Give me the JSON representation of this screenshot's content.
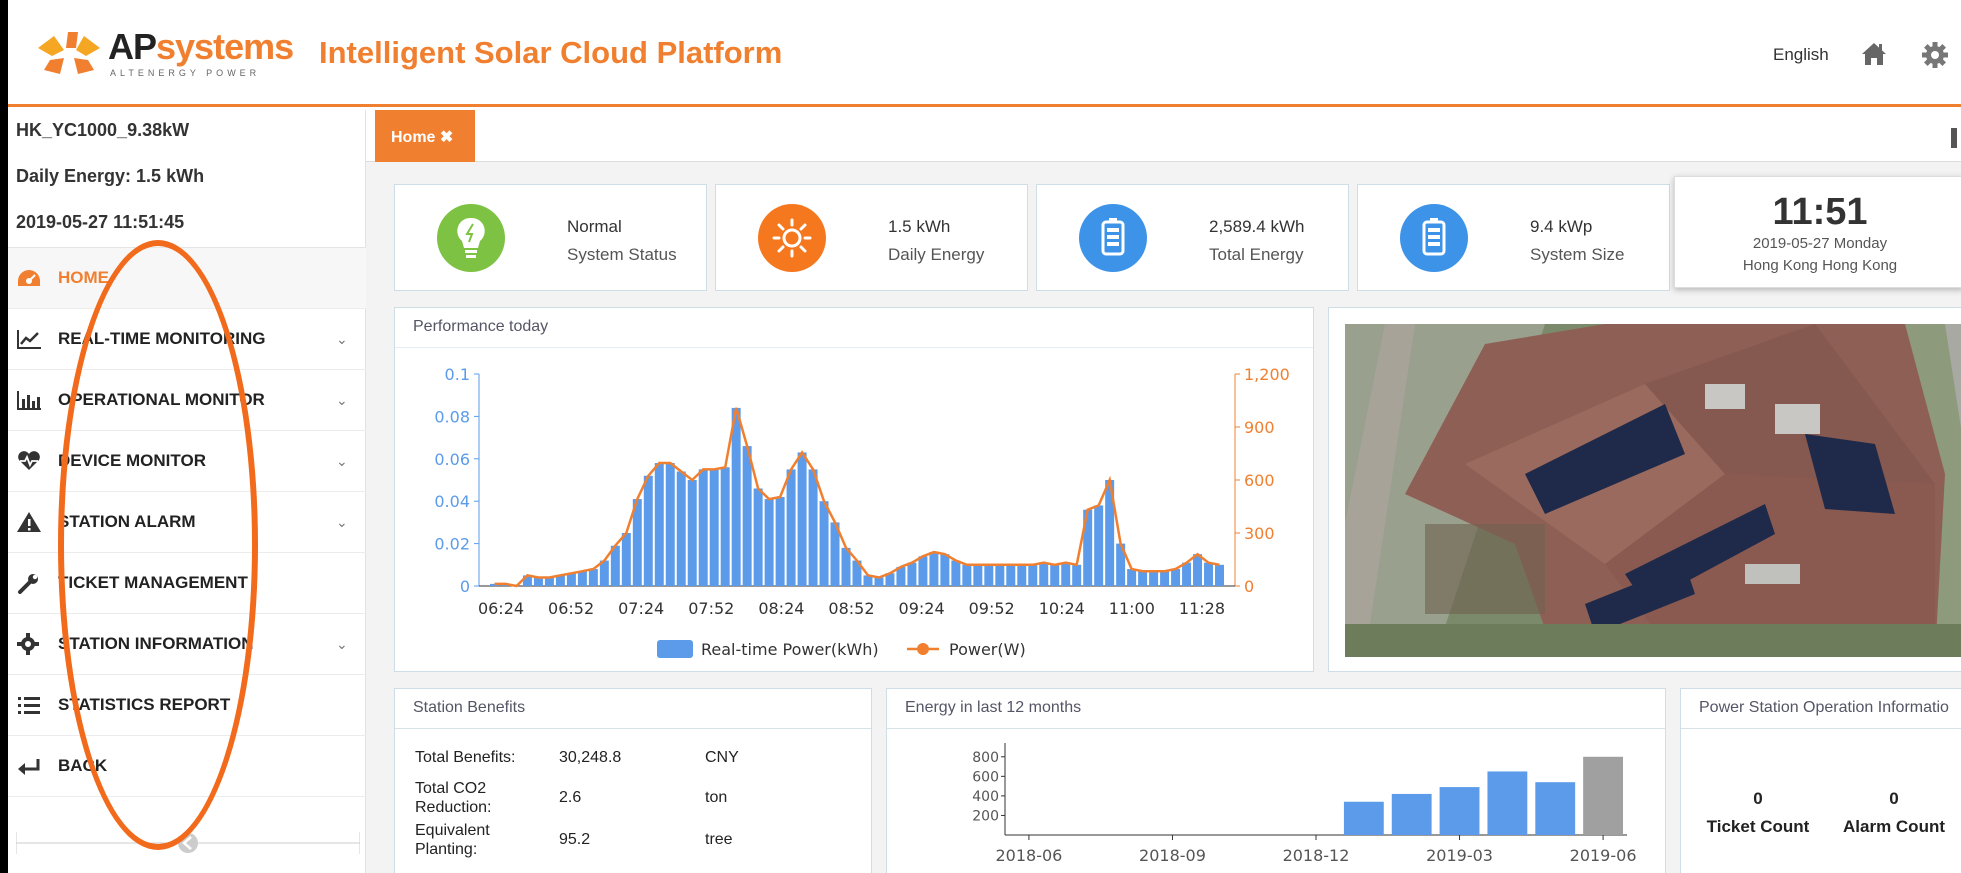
{
  "header": {
    "brand_ap": "AP",
    "brand_systems": "systems",
    "brand_tagline": "ALTENERGY POWER",
    "platform_title": "Intelligent Solar Cloud Platform",
    "language": "English",
    "accent_color": "#f08030"
  },
  "sidebar": {
    "station_name": "HK_YC1000_9.38kW",
    "daily_energy": "Daily Energy: 1.5 kWh",
    "datetime": "2019-05-27 11:51:45",
    "items": [
      {
        "label": "HOME",
        "icon": "dashboard-icon",
        "active": true
      },
      {
        "label": "REAL-TIME MONITORING",
        "icon": "line-chart-icon",
        "chevron": true
      },
      {
        "label": "OPERATIONAL MONITOR",
        "icon": "bar-chart-icon",
        "chevron": true
      },
      {
        "label": "DEVICE MONITOR",
        "icon": "heartbeat-icon",
        "chevron": true
      },
      {
        "label": "STATION ALARM",
        "icon": "warning-icon",
        "chevron": true
      },
      {
        "label": "TICKET MANAGEMENT",
        "icon": "wrench-icon"
      },
      {
        "label": "STATION INFORMATION",
        "icon": "gear-icon",
        "chevron": true
      },
      {
        "label": "STATISTICS REPORT",
        "icon": "list-icon"
      },
      {
        "label": "BACK",
        "icon": "return-icon"
      }
    ]
  },
  "tabs": [
    {
      "label": "Home ✖",
      "active": true
    }
  ],
  "stats": [
    {
      "value": "Normal",
      "label": "System Status",
      "icon": "bulb-icon",
      "color": "#7dc242"
    },
    {
      "value": "1.5  kWh",
      "label": "Daily Energy",
      "icon": "sun-icon",
      "color": "#f5781f"
    },
    {
      "value": "2,589.4  kWh",
      "label": "Total Energy",
      "icon": "battery-icon",
      "color": "#3d93e8"
    },
    {
      "value": "9.4  kWp",
      "label": "System Size",
      "icon": "battery-icon",
      "color": "#3d93e8"
    }
  ],
  "clock": {
    "time": "11:51",
    "date": "2019-05-27    Monday",
    "place": "Hong Kong Hong Kong"
  },
  "performance": {
    "title": "Performance today",
    "legend_bar": "Real-time Power(kWh)",
    "legend_line": "Power(W)"
  },
  "benefits": {
    "title": "Station Benefits",
    "rows": [
      {
        "label": "Total Benefits:",
        "value": "30,248.8",
        "unit": "CNY"
      },
      {
        "label": "Total CO2 Reduction:",
        "value": "2.6",
        "unit": "ton"
      },
      {
        "label": "Equivalent Planting:",
        "value": "95.2",
        "unit": "tree"
      }
    ]
  },
  "energy12": {
    "title": "Energy in last 12 months"
  },
  "operation": {
    "title": "Power Station Operation Informatio",
    "items": [
      {
        "count": "0",
        "label": "Ticket Count"
      },
      {
        "count": "0",
        "label": "Alarm Count"
      }
    ]
  },
  "chart_data": [
    {
      "type": "bar",
      "title": "Performance today",
      "x_ticks": [
        "06:24",
        "06:52",
        "07:24",
        "07:52",
        "08:24",
        "08:52",
        "09:24",
        "09:52",
        "10:24",
        "11:00",
        "11:28"
      ],
      "y_ticks_left": [
        "0",
        "0.02",
        "0.04",
        "0.06",
        "0.08",
        "0.1"
      ],
      "y_ticks_right": [
        "0",
        "300",
        "600",
        "900",
        "1,200"
      ],
      "ylim_left": [
        0,
        0.1
      ],
      "ylim_right": [
        0,
        1200
      ],
      "series": [
        {
          "name": "Real-time Power(kWh)",
          "color": "#5b9bea",
          "values": [
            0.001,
            0.001,
            0,
            0.005,
            0.004,
            0.004,
            0.005,
            0.006,
            0.007,
            0.008,
            0.012,
            0.019,
            0.025,
            0.041,
            0.052,
            0.058,
            0.058,
            0.054,
            0.05,
            0.055,
            0.055,
            0.056,
            0.084,
            0.066,
            0.046,
            0.041,
            0.042,
            0.055,
            0.063,
            0.055,
            0.04,
            0.03,
            0.018,
            0.012,
            0.005,
            0.004,
            0.006,
            0.009,
            0.011,
            0.014,
            0.016,
            0.015,
            0.012,
            0.01,
            0.01,
            0.01,
            0.01,
            0.01,
            0.01,
            0.01,
            0.011,
            0.01,
            0.011,
            0.01,
            0.036,
            0.038,
            0.05,
            0.02,
            0.008,
            0.007,
            0.007,
            0.007,
            0.008,
            0.011,
            0.015,
            0.011,
            0.01
          ]
        },
        {
          "name": "Power(W)",
          "color": "#f08030",
          "values": [
            12,
            12,
            0,
            60,
            48,
            48,
            60,
            72,
            84,
            96,
            144,
            228,
            300,
            492,
            624,
            696,
            696,
            648,
            600,
            660,
            660,
            672,
            1008,
            792,
            552,
            492,
            504,
            660,
            756,
            660,
            480,
            360,
            216,
            144,
            60,
            48,
            72,
            108,
            132,
            168,
            192,
            180,
            144,
            120,
            120,
            120,
            120,
            120,
            120,
            120,
            132,
            120,
            132,
            120,
            432,
            456,
            600,
            240,
            96,
            84,
            84,
            84,
            96,
            132,
            180,
            132,
            120
          ]
        }
      ]
    },
    {
      "type": "bar",
      "title": "Energy in last 12 months",
      "categories": [
        "2018-06",
        "2018-07",
        "2018-08",
        "2018-09",
        "2018-10",
        "2018-11",
        "2018-12",
        "2019-01",
        "2019-02",
        "2019-03",
        "2019-04",
        "2019-05",
        "2019-06"
      ],
      "x_ticks": [
        "2018-06",
        "2018-09",
        "2018-12",
        "2019-03",
        "2019-06"
      ],
      "y_ticks": [
        "200",
        "400",
        "600",
        "800"
      ],
      "values": [
        0,
        0,
        0,
        0,
        0,
        0,
        0,
        340,
        420,
        490,
        650,
        540,
        800
      ],
      "colors": [
        "#5b9bea",
        "#5b9bea",
        "#5b9bea",
        "#5b9bea",
        "#5b9bea",
        "#5b9bea",
        "#5b9bea",
        "#5b9bea",
        "#5b9bea",
        "#5b9bea",
        "#5b9bea",
        "#5b9bea",
        "#a0a0a0"
      ],
      "ylim": [
        0,
        900
      ]
    }
  ]
}
